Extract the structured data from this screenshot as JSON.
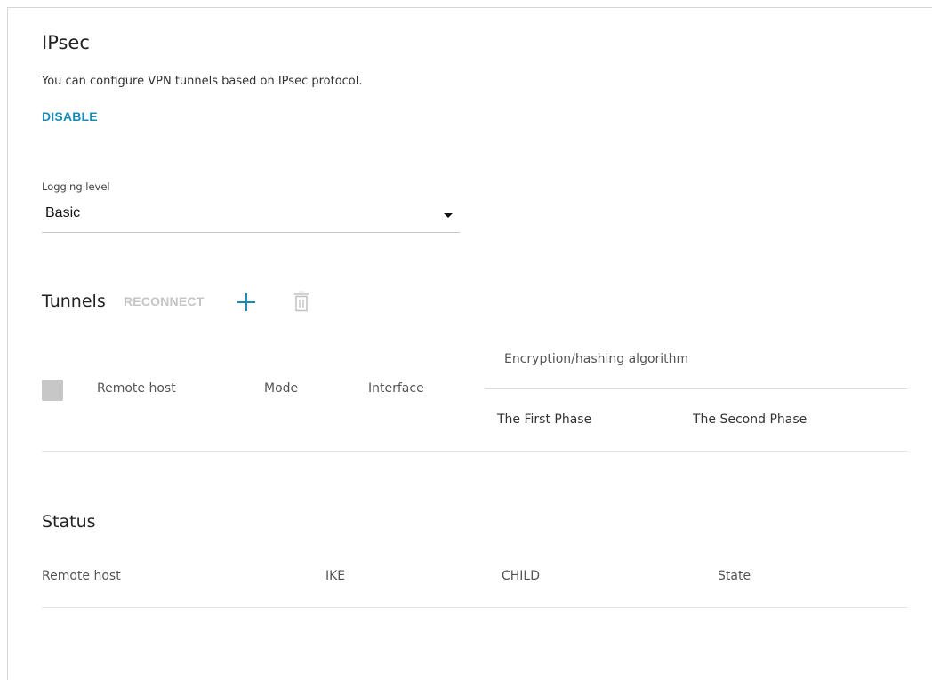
{
  "colors": {
    "accent": "#1a8bb8",
    "disabled_action": "#c5c5c5",
    "checkbox": "#c7c7c7",
    "divider": "#e3e3e3"
  },
  "header": {
    "title": "IPsec",
    "description": "You can configure VPN tunnels based on IPsec protocol.",
    "disable_label": "DISABLE"
  },
  "logging": {
    "label": "Logging level",
    "selected": "Basic",
    "caret_icon": "caret-down-icon"
  },
  "tunnels": {
    "title": "Tunnels",
    "reconnect_label": "RECONNECT",
    "add_icon": "plus-icon",
    "delete_icon": "trash-icon",
    "columns": {
      "remote_host": "Remote host",
      "mode": "Mode",
      "interface": "Interface",
      "encryption": "Encryption/hashing algorithm",
      "first_phase": "The First Phase",
      "second_phase": "The Second Phase"
    },
    "rows": []
  },
  "status": {
    "title": "Status",
    "columns": [
      "Remote host",
      "IKE",
      "CHILD",
      "State"
    ],
    "rows": []
  }
}
